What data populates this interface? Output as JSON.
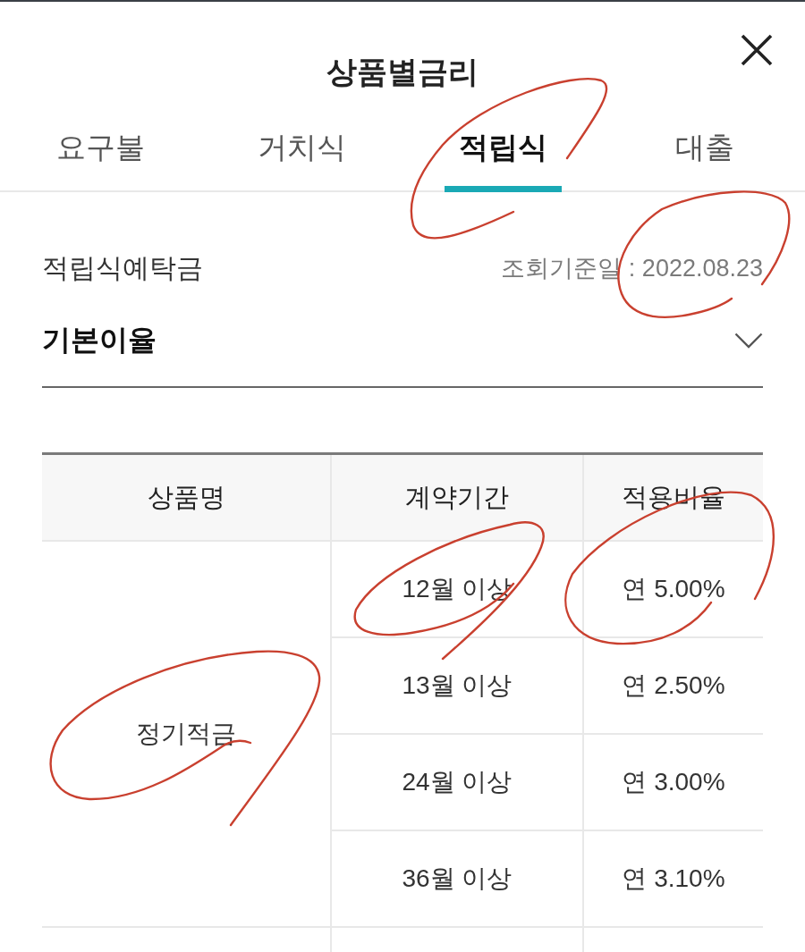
{
  "header": {
    "title": "상품별금리"
  },
  "tabs": [
    {
      "label": "요구불",
      "selected": false
    },
    {
      "label": "거치식",
      "selected": false
    },
    {
      "label": "적립식",
      "selected": true
    },
    {
      "label": "대출",
      "selected": false
    }
  ],
  "section": {
    "category": "적립식예탁금",
    "reference_date": "조회기준일 : 2022.08.23"
  },
  "dropdown": {
    "label": "기본이율",
    "expanded": false
  },
  "table": {
    "columns": [
      "상품명",
      "계약기간",
      "적용비율"
    ],
    "rows": [
      {
        "product": "정기적금",
        "terms": [
          {
            "period": "12월 이상",
            "rate": "연 5.00%"
          },
          {
            "period": "13월 이상",
            "rate": "연 2.50%"
          },
          {
            "period": "24월 이상",
            "rate": "연 3.00%"
          },
          {
            "period": "36월 이상",
            "rate": "연 3.10%"
          }
        ]
      }
    ]
  },
  "pen_marks": [
    {
      "kind": "loop"
    },
    {
      "kind": "loop"
    },
    {
      "kind": "loop"
    },
    {
      "kind": "loop"
    },
    {
      "kind": "loop"
    }
  ]
}
